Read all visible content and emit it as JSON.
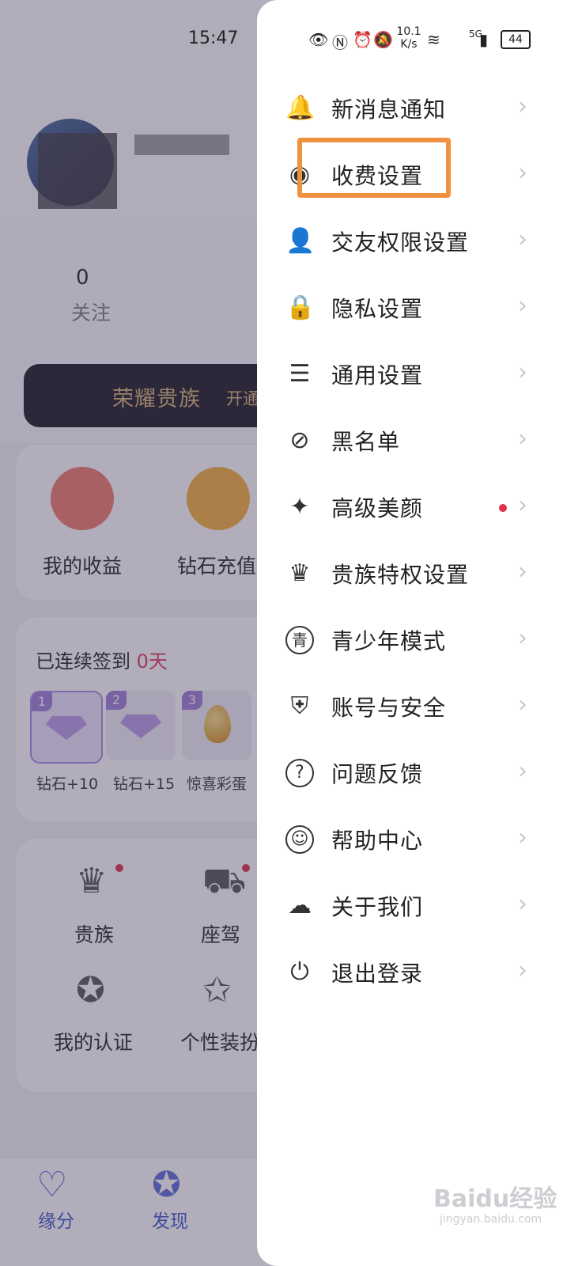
{
  "status_bar": {
    "time": "15:47",
    "speed": "10.1 K/s",
    "network": "5G",
    "battery": "44"
  },
  "background": {
    "follow_count": "0",
    "follow_label": "关注",
    "noble_title": "荣耀贵族",
    "noble_action": "开通",
    "shortcuts": [
      {
        "label": "我的收益",
        "icon": "money-bag-icon"
      },
      {
        "label": "钻石充值",
        "icon": "diamond-icon"
      }
    ],
    "signin": {
      "prefix": "已连续签到",
      "days": "0天",
      "rewards": [
        {
          "num": "1",
          "label": "钻石+10"
        },
        {
          "num": "2",
          "label": "钻石+15"
        },
        {
          "num": "3",
          "label": "惊喜彩蛋"
        }
      ]
    },
    "grid": [
      {
        "label": "贵族",
        "icon": "crown-icon"
      },
      {
        "label": "座驾",
        "icon": "car-icon"
      },
      {
        "label": "我的认证",
        "icon": "verified-badge-icon"
      },
      {
        "label": "个性装扮",
        "icon": "star-badge-icon"
      }
    ],
    "bottom_nav": [
      {
        "label": "缘分",
        "icon": "heart-outline-icon"
      },
      {
        "label": "发现",
        "icon": "star-circle-icon"
      }
    ]
  },
  "drawer": {
    "items": [
      {
        "label": "新消息通知",
        "icon": "bell-icon",
        "glyph": "🔔"
      },
      {
        "label": "收费设置",
        "icon": "coin-icon",
        "glyph": "◉"
      },
      {
        "label": "交友权限设置",
        "icon": "user-key-icon",
        "glyph": "👤"
      },
      {
        "label": "隐私设置",
        "icon": "lock-icon",
        "glyph": "🔒"
      },
      {
        "label": "通用设置",
        "icon": "document-icon",
        "glyph": "☰"
      },
      {
        "label": "黑名单",
        "icon": "user-block-icon",
        "glyph": "⊘"
      },
      {
        "label": "高级美颜",
        "icon": "magic-wand-icon",
        "glyph": "✦",
        "has_dot": true
      },
      {
        "label": "贵族特权设置",
        "icon": "crown-icon",
        "glyph": "♛"
      },
      {
        "label": "青少年模式",
        "icon": "youth-mode-icon",
        "glyph": "青"
      },
      {
        "label": "账号与安全",
        "icon": "shield-check-icon",
        "glyph": "⛨"
      },
      {
        "label": "问题反馈",
        "icon": "question-icon",
        "glyph": "?"
      },
      {
        "label": "帮助中心",
        "icon": "help-person-icon",
        "glyph": "☺"
      },
      {
        "label": "关于我们",
        "icon": "cloud-download-icon",
        "glyph": "☁"
      },
      {
        "label": "退出登录",
        "icon": "power-icon",
        "glyph": "⏻"
      }
    ],
    "highlighted_item": "收费设置"
  },
  "watermark": {
    "text": "Baidu经验",
    "sub": "jingyan.baidu.com"
  },
  "colors": {
    "accent_red": "#e0324b",
    "highlight_orange": "#f0913f",
    "nav_blue": "#3d56c9"
  }
}
